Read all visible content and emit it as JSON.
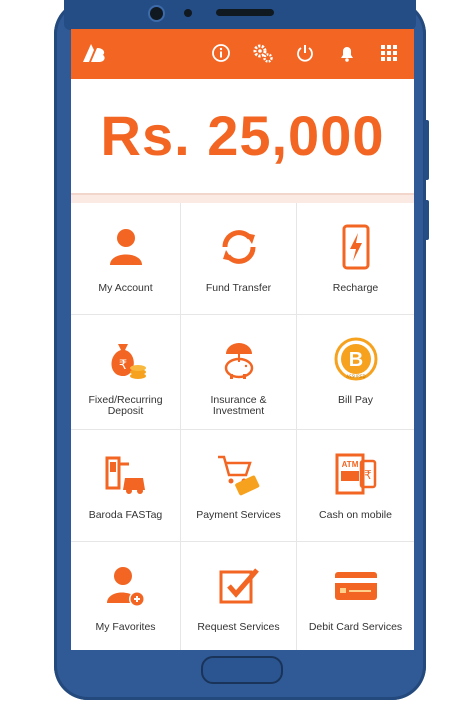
{
  "header": {
    "icons": [
      "bank-logo-icon",
      "info-icon",
      "settings-icon",
      "power-icon",
      "bell-icon",
      "grid-menu-icon"
    ]
  },
  "balance": {
    "amount": "Rs. 25,000"
  },
  "tiles": [
    {
      "label": "My Account",
      "icon": "person-icon"
    },
    {
      "label": "Fund Transfer",
      "icon": "refresh-arrows-icon"
    },
    {
      "label": "Recharge",
      "icon": "mobile-bolt-icon"
    },
    {
      "label": "Fixed/Recurring Deposit",
      "icon": "money-bag-icon"
    },
    {
      "label": "Insurance & Investment",
      "icon": "piggy-bank-umbrella-icon"
    },
    {
      "label": "Bill Pay",
      "icon": "bbps-logo-icon"
    },
    {
      "label": "Baroda FASTag",
      "icon": "toll-car-icon"
    },
    {
      "label": "Payment Services",
      "icon": "cart-card-icon"
    },
    {
      "label": "Cash on mobile",
      "icon": "atm-icon"
    },
    {
      "label": "My Favorites",
      "icon": "person-heart-icon"
    },
    {
      "label": "Request Services",
      "icon": "checkbox-icon"
    },
    {
      "label": "Debit Card Services",
      "icon": "card-icon"
    }
  ],
  "badge_text": "ASSURED",
  "colors": {
    "accent": "#f26522",
    "frame": "#2f5a96"
  }
}
